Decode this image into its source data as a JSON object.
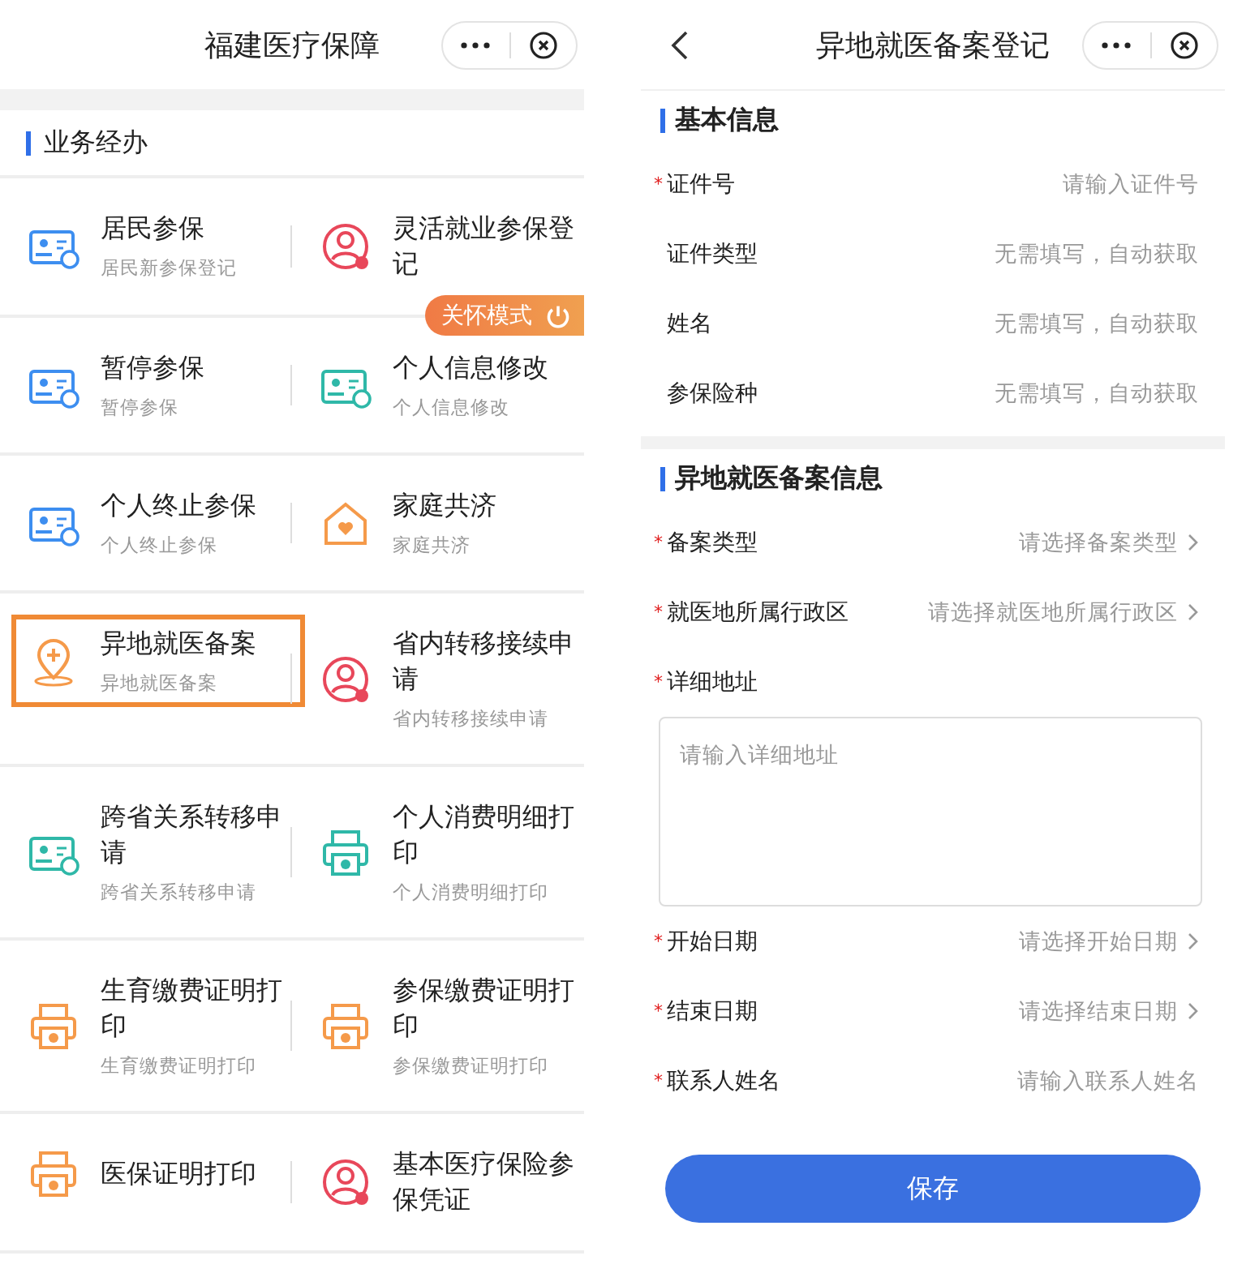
{
  "home": {
    "title": "福建医疗保障",
    "section_title": "业务经办",
    "services": [
      {
        "title": "居民参保",
        "subtitle": "居民新参保登记",
        "kind": "card",
        "color": "#3d8ef0",
        "selected": false
      },
      {
        "title": "灵活就业参保登记",
        "kind": "person",
        "color": "#e8475a",
        "selected": false
      },
      {
        "title": "暂停参保",
        "subtitle": "暂停参保",
        "kind": "card",
        "color": "#3d8ef0",
        "selected": false
      },
      {
        "title": "个人信息修改",
        "subtitle": "个人信息修改",
        "kind": "card",
        "color": "#2fb8a8",
        "selected": false
      },
      {
        "title": "个人终止参保",
        "subtitle": "个人终止参保",
        "kind": "card",
        "color": "#3d8ef0",
        "selected": false
      },
      {
        "title": "家庭共济",
        "subtitle": "家庭共济",
        "kind": "house",
        "color": "#f59a4a",
        "selected": false
      },
      {
        "title": "异地就医备案",
        "subtitle": "异地就医备案",
        "kind": "pin",
        "color": "#f59a4a",
        "selected": true
      },
      {
        "title": "省内转移接续申请",
        "subtitle": "省内转移接续申请",
        "kind": "person",
        "color": "#e8475a",
        "selected": false
      },
      {
        "title": "跨省关系转移申请",
        "subtitle": "跨省关系转移申请",
        "kind": "card",
        "color": "#2fb8a8",
        "selected": false
      },
      {
        "title": "个人消费明细打印",
        "subtitle": "个人消费明细打印",
        "kind": "printer",
        "color": "#2fb8a8",
        "selected": false
      },
      {
        "title": "生育缴费证明打印",
        "subtitle": "生育缴费证明打印",
        "kind": "printer",
        "color": "#f59a4a",
        "selected": false
      },
      {
        "title": "参保缴费证明打印",
        "subtitle": "参保缴费证明打印",
        "kind": "printer",
        "color": "#f59a4a",
        "selected": false
      },
      {
        "title": "医保证明打印",
        "kind": "printer",
        "color": "#f59a4a",
        "selected": false
      },
      {
        "title": "基本医疗保险参保凭证",
        "kind": "person",
        "color": "#e8475a",
        "selected": false
      }
    ],
    "care_mode_button": "关怀模式"
  },
  "form": {
    "title": "异地就医备案登记",
    "sections": [
      {
        "title": "基本信息",
        "fields": [
          {
            "label": "证件号",
            "required_mark": "*",
            "kind": "input",
            "placeholder": "请输入证件号"
          },
          {
            "label": "证件类型",
            "kind": "auto",
            "placeholder": "无需填写，自动获取"
          },
          {
            "label": "姓名",
            "kind": "auto",
            "placeholder": "无需填写，自动获取"
          },
          {
            "label": "参保险种",
            "kind": "auto",
            "placeholder": "无需填写，自动获取"
          }
        ]
      },
      {
        "title": "异地就医备案信息",
        "fields": [
          {
            "label": "备案类型",
            "required_mark": "*",
            "kind": "select",
            "placeholder": "请选择备案类型"
          },
          {
            "label": "就医地所属行政区",
            "required_mark": "*",
            "kind": "select",
            "placeholder": "请选择就医地所属行政区"
          },
          {
            "label": "详细地址",
            "required_mark": "*",
            "kind": "textarea",
            "placeholder": "请输入详细地址"
          },
          {
            "label": "开始日期",
            "required_mark": "*",
            "kind": "select",
            "placeholder": "请选择开始日期"
          },
          {
            "label": "结束日期",
            "required_mark": "*",
            "kind": "select",
            "placeholder": "请选择结束日期"
          },
          {
            "label": "联系人姓名",
            "required_mark": "*",
            "kind": "input",
            "placeholder": "请输入联系人姓名"
          }
        ]
      }
    ],
    "save_button": "保存"
  }
}
